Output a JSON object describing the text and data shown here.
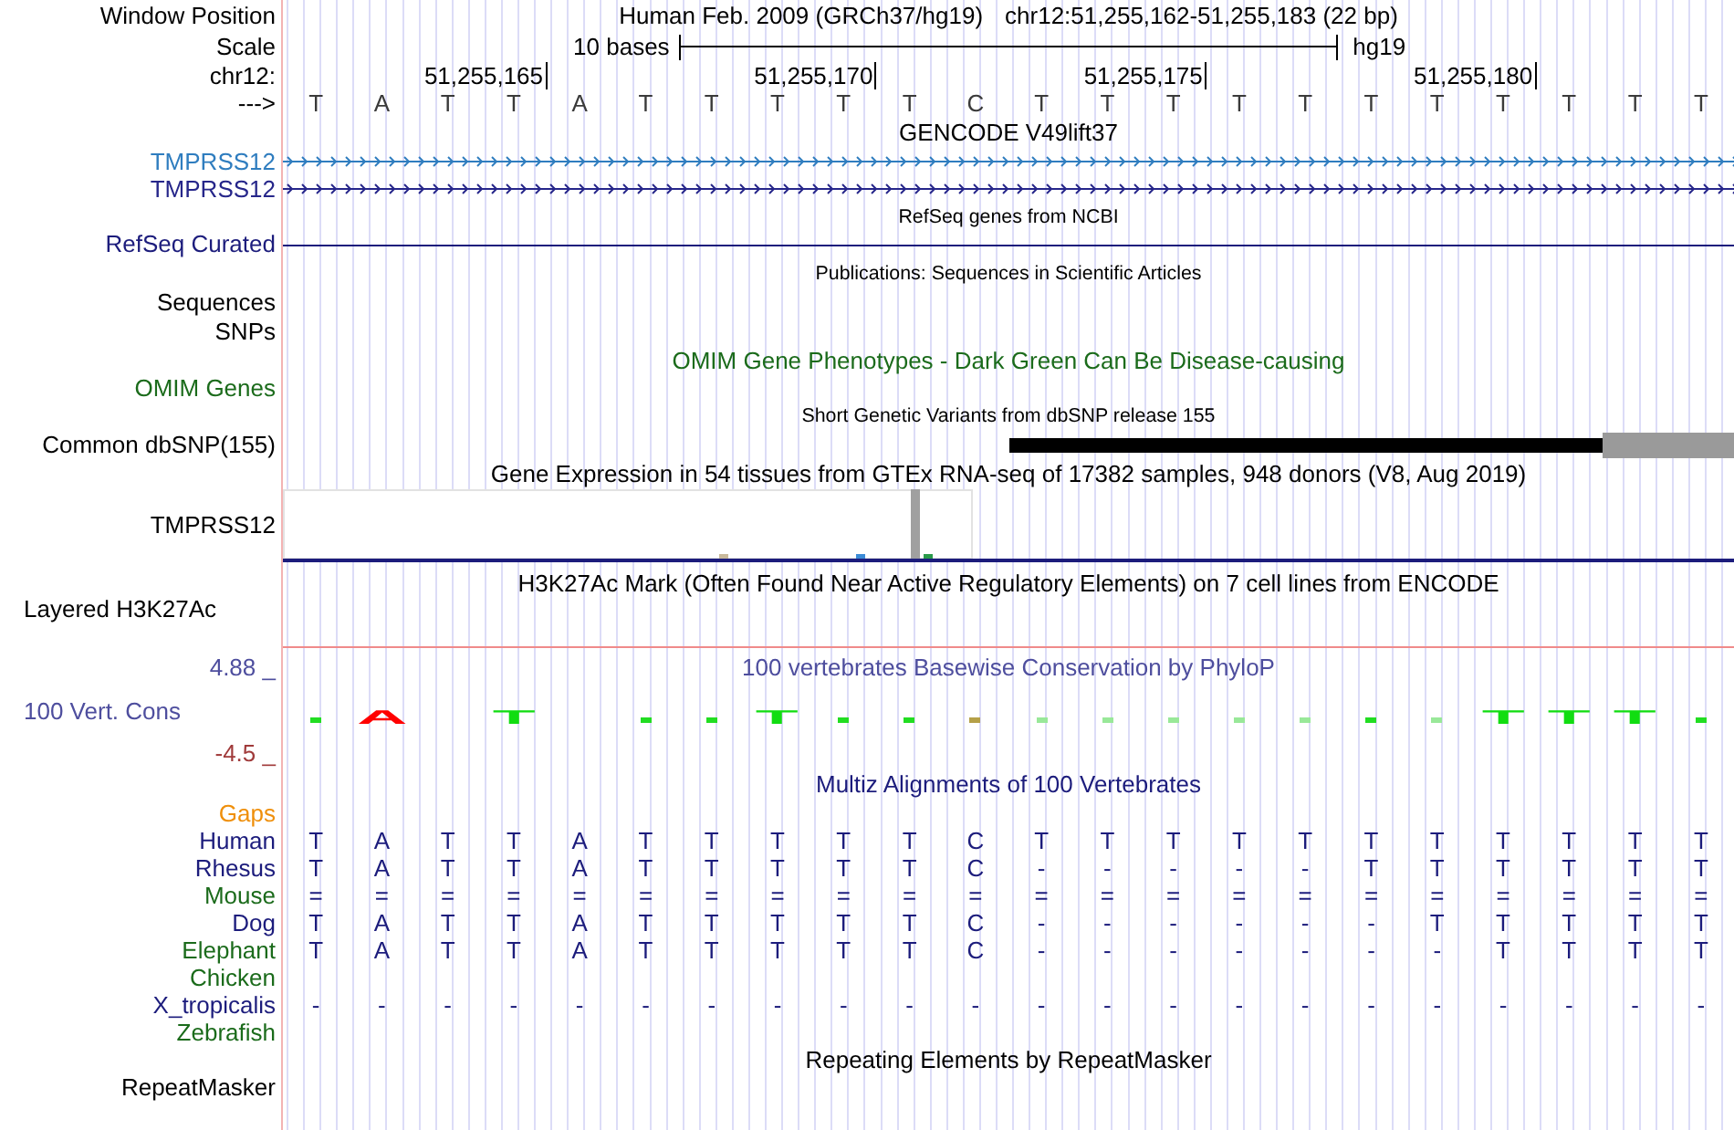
{
  "window_position": {
    "label": "Window Position",
    "assembly": "Human Feb. 2009 (GRCh37/hg19)",
    "range": "chr12:51,255,162-51,255,183 (22 bp)"
  },
  "scale": {
    "label": "Scale",
    "length": "10 bases",
    "assembly": "hg19"
  },
  "ruler": {
    "label": "chr12:",
    "ticks": [
      "51,255,165",
      "51,255,170",
      "51,255,175",
      "51,255,180"
    ]
  },
  "sequence": {
    "label": "--->",
    "bases": [
      "T",
      "A",
      "T",
      "T",
      "A",
      "T",
      "T",
      "T",
      "T",
      "T",
      "C",
      "T",
      "T",
      "T",
      "T",
      "T",
      "T",
      "T",
      "T",
      "T",
      "T",
      "T"
    ]
  },
  "gencode": {
    "title": "GENCODE V49lift37",
    "transcripts": [
      {
        "name": "TMPRSS12",
        "color": "#2f7dbf"
      },
      {
        "name": "TMPRSS12",
        "color": "#26268a"
      }
    ]
  },
  "refseq": {
    "title": "RefSeq genes from NCBI",
    "label": "RefSeq Curated"
  },
  "publications": {
    "title": "Publications: Sequences in Scientific Articles",
    "labels": [
      "Sequences",
      "SNPs"
    ]
  },
  "omim": {
    "title": "OMIM Gene Phenotypes - Dark Green Can Be Disease-causing",
    "label": "OMIM Genes"
  },
  "dbsnp": {
    "title": "Short Genetic Variants from dbSNP release 155",
    "label": "Common dbSNP(155)"
  },
  "gtex": {
    "title": "Gene Expression in 54 tissues from GTEx RNA-seq of 17382 samples, 948 donors (V8, Aug 2019)",
    "label": "TMPRSS12"
  },
  "h3k27ac": {
    "title": "H3K27Ac Mark (Often Found Near Active Regulatory Elements) on 7 cell lines from ENCODE",
    "label": "Layered H3K27Ac"
  },
  "conservation": {
    "title": "100 vertebrates Basewise Conservation by PhyloP",
    "label": "100 Vert. Cons",
    "max": "4.88 _",
    "min": "-4.5 _",
    "glyphs": [
      {
        "kind": "mark",
        "color": "#22dd22"
      },
      {
        "kind": "letter",
        "letter": "A",
        "color": "#ff0000"
      },
      {
        "kind": "blank"
      },
      {
        "kind": "letter",
        "letter": "T",
        "color": "#11dd11"
      },
      {
        "kind": "blank"
      },
      {
        "kind": "mark",
        "color": "#22dd22"
      },
      {
        "kind": "mark",
        "color": "#22dd22"
      },
      {
        "kind": "letter",
        "letter": "T",
        "color": "#11dd11"
      },
      {
        "kind": "mark",
        "color": "#22dd22"
      },
      {
        "kind": "mark",
        "color": "#22dd22"
      },
      {
        "kind": "mark",
        "color": "#b5a048"
      },
      {
        "kind": "mark",
        "color": "#99e899"
      },
      {
        "kind": "mark",
        "color": "#99e899"
      },
      {
        "kind": "mark",
        "color": "#99e899"
      },
      {
        "kind": "mark",
        "color": "#99e899"
      },
      {
        "kind": "mark",
        "color": "#99e899"
      },
      {
        "kind": "mark",
        "color": "#22dd22"
      },
      {
        "kind": "mark",
        "color": "#99e899"
      },
      {
        "kind": "letter",
        "letter": "T",
        "color": "#11dd11"
      },
      {
        "kind": "letter",
        "letter": "T",
        "color": "#11dd11"
      },
      {
        "kind": "letter",
        "letter": "T",
        "color": "#11dd11"
      },
      {
        "kind": "mark",
        "color": "#22dd22"
      }
    ]
  },
  "multiz": {
    "title": "Multiz Alignments of 100 Vertebrates",
    "gaps_label": "Gaps",
    "species": [
      {
        "name": "Human",
        "color": "#1c1c7c",
        "bases": [
          "T",
          "A",
          "T",
          "T",
          "A",
          "T",
          "T",
          "T",
          "T",
          "T",
          "C",
          "T",
          "T",
          "T",
          "T",
          "T",
          "T",
          "T",
          "T",
          "T",
          "T",
          "T"
        ]
      },
      {
        "name": "Rhesus",
        "color": "#1c1c7c",
        "bases": [
          "T",
          "A",
          "T",
          "T",
          "A",
          "T",
          "T",
          "T",
          "T",
          "T",
          "C",
          "-",
          "-",
          "-",
          "-",
          "-",
          "T",
          "T",
          "T",
          "T",
          "T",
          "T"
        ]
      },
      {
        "name": "Mouse",
        "color": "#1b6b1b",
        "bases": [
          "=",
          "=",
          "=",
          "=",
          "=",
          "=",
          "=",
          "=",
          "=",
          "=",
          "=",
          "=",
          "=",
          "=",
          "=",
          "=",
          "=",
          "=",
          "=",
          "=",
          "=",
          "="
        ]
      },
      {
        "name": "Dog",
        "color": "#1c1c7c",
        "bases": [
          "T",
          "A",
          "T",
          "T",
          "A",
          "T",
          "T",
          "T",
          "T",
          "T",
          "C",
          "-",
          "-",
          "-",
          "-",
          "-",
          "-",
          "T",
          "T",
          "T",
          "T",
          "T"
        ]
      },
      {
        "name": "Elephant",
        "color": "#1b6b1b",
        "bases": [
          "T",
          "A",
          "T",
          "T",
          "A",
          "T",
          "T",
          "T",
          "T",
          "T",
          "C",
          "-",
          "-",
          "-",
          "-",
          "-",
          "-",
          "-",
          "T",
          "T",
          "T",
          "T"
        ]
      },
      {
        "name": "Chicken",
        "color": "#1b6b1b"
      },
      {
        "name": "X_tropicalis",
        "color": "#1c1c7c",
        "bases": [
          "-",
          "-",
          "-",
          "-",
          "-",
          "-",
          "-",
          "-",
          "-",
          "-",
          "-",
          "-",
          "-",
          "-",
          "-",
          "-",
          "-",
          "-",
          "-",
          "-",
          "-",
          "-"
        ]
      },
      {
        "name": "Zebrafish",
        "color": "#1b6b1b"
      }
    ]
  },
  "repeatmasker": {
    "title": "Repeating Elements by RepeatMasker",
    "label": "RepeatMasker"
  }
}
